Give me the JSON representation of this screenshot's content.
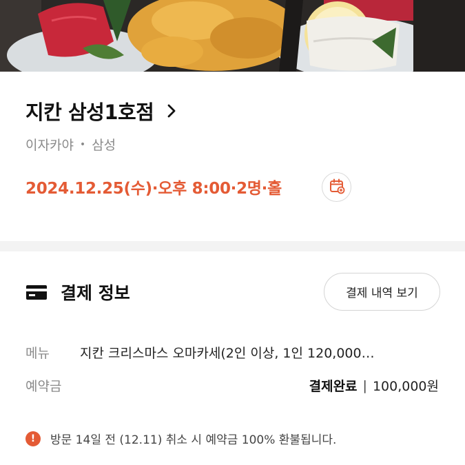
{
  "restaurant": {
    "name": "지칸 삼성1호점",
    "category": "이자카야",
    "separator": "•",
    "area": "삼성"
  },
  "reservation": {
    "summary": "2024.12.25(수)·오후 8:00·2명·홀"
  },
  "payment": {
    "section_title": "결제 정보",
    "history_button": "결제 내역 보기",
    "menu_label": "메뉴",
    "menu_value": "지칸 크리스마스 오마카세(2인 이상, 1인 120,000…",
    "deposit_label": "예약금",
    "deposit_status": "결제완료",
    "deposit_separator": "|",
    "deposit_amount": "100,000원"
  },
  "notice": {
    "icon_glyph": "!",
    "text": "방문 14일 전 (12.11) 취소 시 예약금 100% 환불됩니다."
  },
  "icons": {
    "title_chevron": "chevron-right-icon",
    "calendar": "calendar-add-icon",
    "card": "credit-card-icon",
    "info": "info-icon"
  },
  "colors": {
    "accent": "#e45b35",
    "muted_text": "#8a8a8a",
    "divider": "#f3f3f3"
  }
}
